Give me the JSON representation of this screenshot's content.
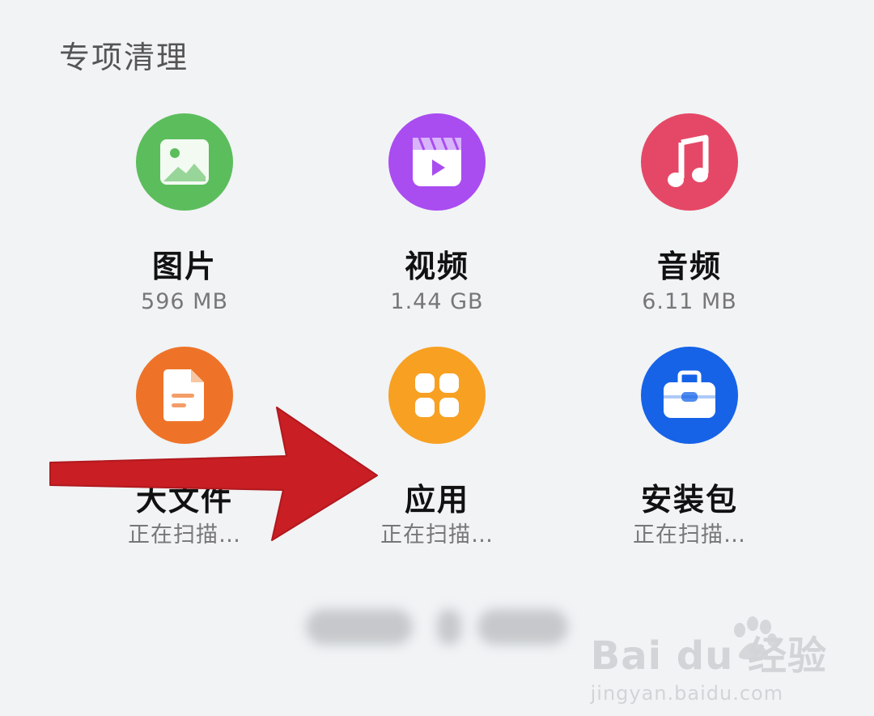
{
  "section": {
    "title": "专项清理"
  },
  "tiles": [
    {
      "name": "图片",
      "size": "596 MB",
      "icon": "image-icon",
      "color": "#5cbd5c"
    },
    {
      "name": "视频",
      "size": "1.44 GB",
      "icon": "video-icon",
      "color": "#a94cf0"
    },
    {
      "name": "音频",
      "size": "6.11 MB",
      "icon": "music-icon",
      "color": "#e54866"
    },
    {
      "name": "大文件",
      "size": "正在扫描…",
      "icon": "document-icon",
      "color": "#ee7328"
    },
    {
      "name": "应用",
      "size": "正在扫描…",
      "icon": "apps-icon",
      "color": "#f7a022"
    },
    {
      "name": "安装包",
      "size": "正在扫描…",
      "icon": "package-icon",
      "color": "#1663e8"
    }
  ],
  "watermark": {
    "brand": "Bai du 经验",
    "url": "jingyan.baidu.com"
  },
  "annotation": {
    "arrow_color": "#c81e24"
  }
}
